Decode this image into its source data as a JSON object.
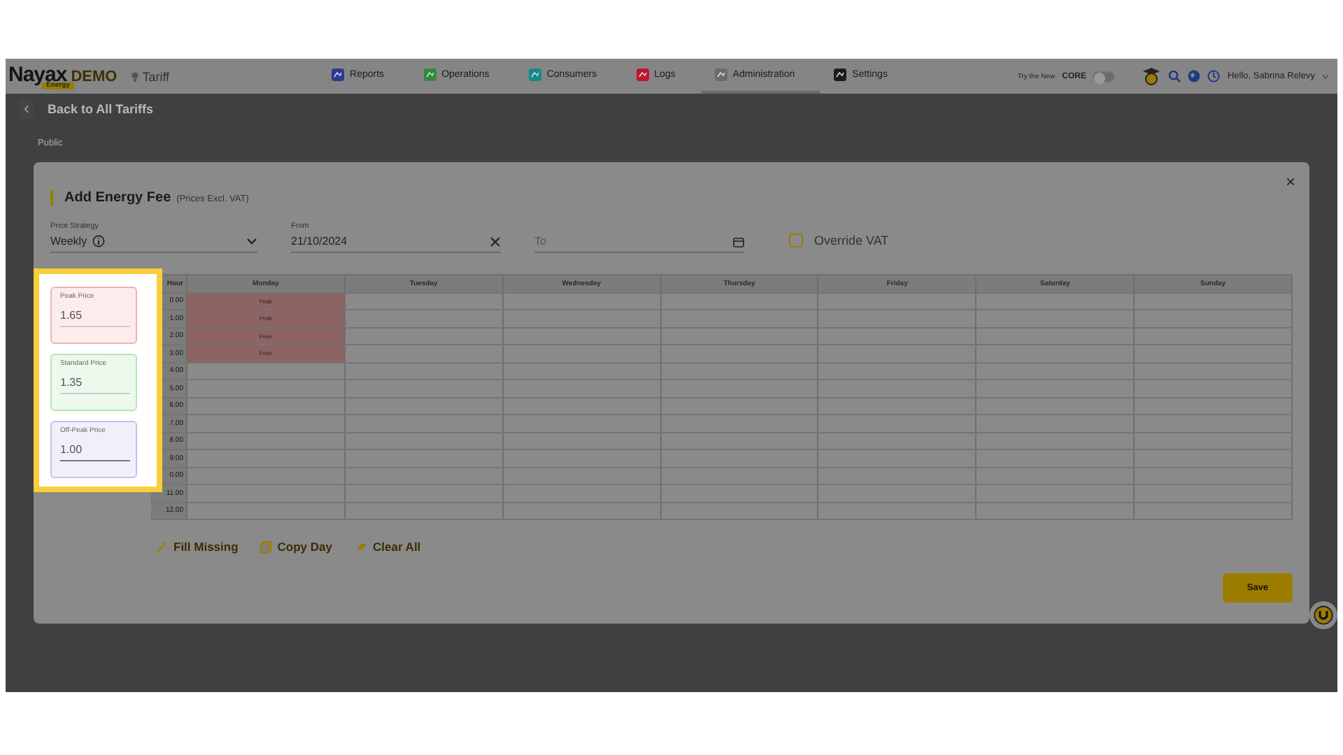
{
  "header": {
    "logo": "Nayax",
    "logo_tag": "DEMO",
    "logo_sub": "Energy",
    "breadcrumb": "Tariff",
    "nav": [
      {
        "label": "Reports",
        "color": "#2c3a8c",
        "selected": false
      },
      {
        "label": "Operations",
        "color": "#2f8a3a",
        "selected": false
      },
      {
        "label": "Consumers",
        "color": "#138a8a",
        "selected": false
      },
      {
        "label": "Logs",
        "color": "#c0142c",
        "selected": false
      },
      {
        "label": "Administration",
        "color": "#6a6a6a",
        "selected": true
      },
      {
        "label": "Settings",
        "color": "#1a1a1a",
        "selected": false
      }
    ],
    "try_text": "Try the New",
    "try_brand": "CORE",
    "core_toggle": {
      "on": false
    },
    "user": "Hello, Sabrina Relevy"
  },
  "page": {
    "back": "Back to All Tariffs",
    "subtitle": "Public"
  },
  "modal": {
    "close": "×",
    "title": "Add Energy Fee",
    "title_note": "(Prices Excl. VAT)",
    "price_strategy": {
      "label": "Price Strategy",
      "value": "Weekly"
    },
    "from": {
      "label": "From",
      "value": "21/10/2024"
    },
    "to": {
      "placeholder": "To"
    },
    "override_vat": {
      "label": "Override VAT",
      "checked": false
    },
    "prices": [
      {
        "label": "Peak Price",
        "value": "1.65",
        "color": "#f2b3b3"
      },
      {
        "label": "Standard Price",
        "value": "1.35",
        "color": "#b5e6b2"
      },
      {
        "label": "Off-Peak Price",
        "value": "1.00",
        "color": "#c2c2f0"
      }
    ],
    "schedule": {
      "columns": [
        "Hour",
        "Monday",
        "Tuesday",
        "Wednesday",
        "Thursday",
        "Friday",
        "Saturday",
        "Sunday"
      ],
      "rows": [
        {
          "hour": "0.00",
          "cells": [
            {
              "kind": "peak",
              "text": "Peak"
            },
            {
              "kind": "empty"
            },
            {
              "kind": "empty"
            },
            {
              "kind": "empty"
            },
            {
              "kind": "empty"
            },
            {
              "kind": "empty"
            },
            {
              "kind": "empty"
            }
          ]
        },
        {
          "hour": "1.00",
          "cells": [
            {
              "kind": "peak",
              "text": "Peak"
            },
            {
              "kind": "empty"
            },
            {
              "kind": "empty"
            },
            {
              "kind": "empty"
            },
            {
              "kind": "empty"
            },
            {
              "kind": "empty"
            },
            {
              "kind": "empty"
            }
          ]
        },
        {
          "hour": "2.00",
          "cells": [
            {
              "kind": "peak",
              "text": "Peak"
            },
            {
              "kind": "empty"
            },
            {
              "kind": "empty"
            },
            {
              "kind": "empty"
            },
            {
              "kind": "empty"
            },
            {
              "kind": "empty"
            },
            {
              "kind": "empty"
            }
          ]
        },
        {
          "hour": "3.00",
          "cells": [
            {
              "kind": "peak",
              "text": "Peak"
            },
            {
              "kind": "empty"
            },
            {
              "kind": "empty"
            },
            {
              "kind": "empty"
            },
            {
              "kind": "empty"
            },
            {
              "kind": "empty"
            },
            {
              "kind": "empty"
            }
          ]
        },
        {
          "hour": "4.00",
          "cells": [
            {
              "kind": "empty"
            },
            {
              "kind": "empty"
            },
            {
              "kind": "empty"
            },
            {
              "kind": "empty"
            },
            {
              "kind": "empty"
            },
            {
              "kind": "empty"
            },
            {
              "kind": "empty"
            }
          ]
        },
        {
          "hour": "5.00",
          "cells": [
            {
              "kind": "empty"
            },
            {
              "kind": "empty"
            },
            {
              "kind": "empty"
            },
            {
              "kind": "empty"
            },
            {
              "kind": "empty"
            },
            {
              "kind": "empty"
            },
            {
              "kind": "empty"
            }
          ]
        },
        {
          "hour": "6.00",
          "cells": [
            {
              "kind": "empty"
            },
            {
              "kind": "empty"
            },
            {
              "kind": "empty"
            },
            {
              "kind": "empty"
            },
            {
              "kind": "empty"
            },
            {
              "kind": "empty"
            },
            {
              "kind": "empty"
            }
          ]
        },
        {
          "hour": "7.00",
          "cells": [
            {
              "kind": "empty"
            },
            {
              "kind": "empty"
            },
            {
              "kind": "empty"
            },
            {
              "kind": "empty"
            },
            {
              "kind": "empty"
            },
            {
              "kind": "empty"
            },
            {
              "kind": "empty"
            }
          ]
        },
        {
          "hour": "8.00",
          "cells": [
            {
              "kind": "empty"
            },
            {
              "kind": "empty"
            },
            {
              "kind": "empty"
            },
            {
              "kind": "empty"
            },
            {
              "kind": "empty"
            },
            {
              "kind": "empty"
            },
            {
              "kind": "empty"
            }
          ]
        },
        {
          "hour": "9.00",
          "cells": [
            {
              "kind": "empty"
            },
            {
              "kind": "empty"
            },
            {
              "kind": "empty"
            },
            {
              "kind": "empty"
            },
            {
              "kind": "empty"
            },
            {
              "kind": "empty"
            },
            {
              "kind": "empty"
            }
          ]
        },
        {
          "hour": "0.00",
          "cells": [
            {
              "kind": "empty"
            },
            {
              "kind": "empty"
            },
            {
              "kind": "empty"
            },
            {
              "kind": "empty"
            },
            {
              "kind": "empty"
            },
            {
              "kind": "empty"
            },
            {
              "kind": "empty"
            }
          ]
        },
        {
          "hour": "11.00",
          "cells": [
            {
              "kind": "empty"
            },
            {
              "kind": "empty"
            },
            {
              "kind": "empty"
            },
            {
              "kind": "empty"
            },
            {
              "kind": "empty"
            },
            {
              "kind": "empty"
            },
            {
              "kind": "empty"
            }
          ]
        },
        {
          "hour": "12.00",
          "cells": [
            {
              "kind": "empty"
            },
            {
              "kind": "empty"
            },
            {
              "kind": "empty"
            },
            {
              "kind": "empty"
            },
            {
              "kind": "empty"
            },
            {
              "kind": "empty"
            },
            {
              "kind": "empty"
            }
          ]
        }
      ]
    },
    "actions": [
      {
        "kind": "wand",
        "label": "Fill Missing"
      },
      {
        "kind": "copy",
        "label": "Copy Day"
      },
      {
        "kind": "eraser",
        "label": "Clear All"
      }
    ],
    "save": "Save"
  }
}
